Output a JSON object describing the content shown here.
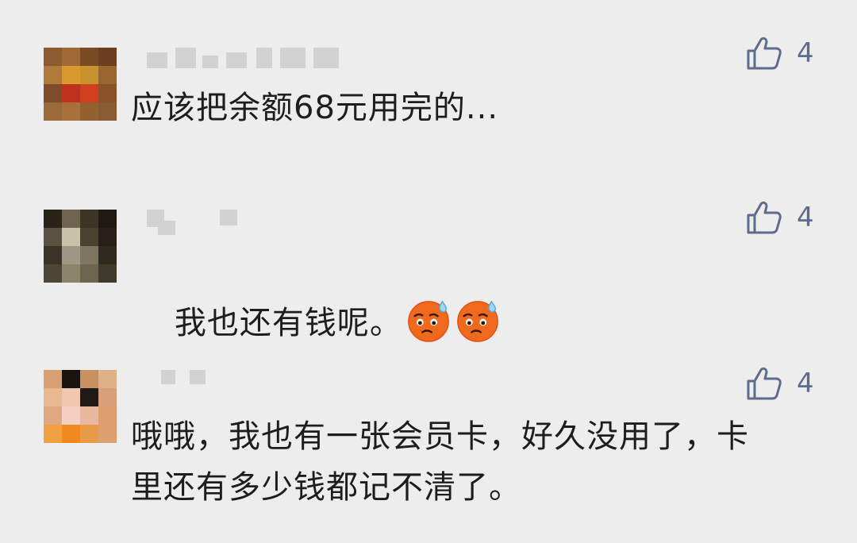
{
  "comments": [
    {
      "text": "应该把余额68元用完的...",
      "likes": "4",
      "avatar_colors": [
        "#8c5a2e",
        "#a06a36",
        "#7a4a26",
        "#6b3e20",
        "#b07a3a",
        "#d89a2e",
        "#c8922e",
        "#9a6630",
        "#7e4c2c",
        "#c0301e",
        "#d04020",
        "#8a5228",
        "#9a6a3a",
        "#a8703a",
        "#946030",
        "#8a5a32"
      ]
    },
    {
      "text": "我也还有钱呢。",
      "likes": "4",
      "emojis": [
        "sweat-smile-emoji",
        "sweat-smile-emoji"
      ],
      "avatar_colors": [
        "#2a2418",
        "#6e6450",
        "#3c3424",
        "#1e1a12",
        "#5a5240",
        "#c8c2a8",
        "#4a4230",
        "#262018",
        "#3a3428",
        "#9e9884",
        "#7e7660",
        "#2e2a20",
        "#4c4636",
        "#8a846c",
        "#6a6450",
        "#3e3a2c"
      ]
    },
    {
      "text": "哦哦，我也有一张会员卡，好久没用了，卡里还有多少钱都记不清了。",
      "likes": "4",
      "avatar_colors": [
        "#d8a070",
        "#1a1410",
        "#c89060",
        "#e0b088",
        "#e8b890",
        "#f0c8b0",
        "#201a16",
        "#d8a078",
        "#e0a880",
        "#f4d0c0",
        "#e8b8a0",
        "#dca070",
        "#f0a040",
        "#f08a20",
        "#e89a48",
        "#dca070"
      ]
    }
  ],
  "colors": {
    "background": "#ededed",
    "text": "#1d1d1d",
    "like": "#5d6c8c"
  }
}
